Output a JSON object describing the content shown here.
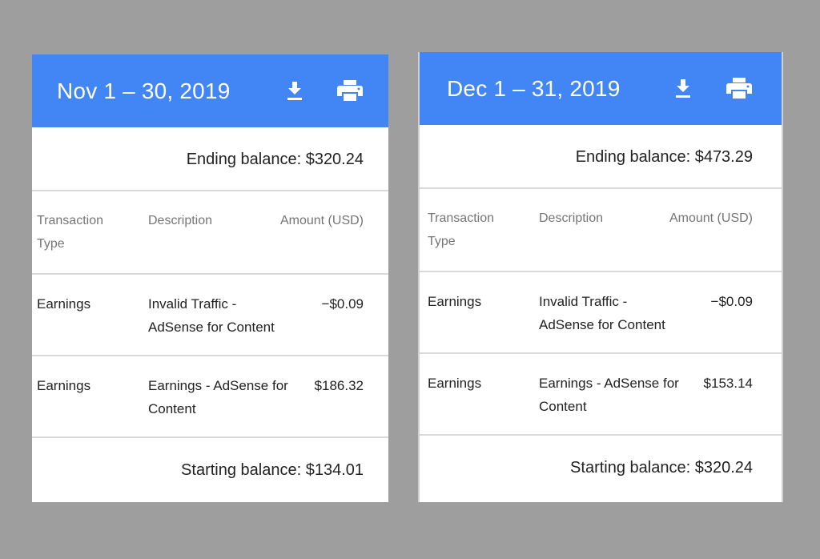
{
  "colors": {
    "header_bg": "#4285f4",
    "page_bg": "#9e9e9e",
    "card_bg": "#ffffff",
    "divider": "#d9d9d9"
  },
  "statements": [
    {
      "title": "Nov 1 – 30, 2019",
      "icons": {
        "download": "download-icon",
        "print": "print-icon"
      },
      "ending_balance": "Ending balance: $320.24",
      "columns": {
        "type": "Transaction Type",
        "description": "Description",
        "amount": "Amount (USD)"
      },
      "transactions": [
        {
          "type": "Earnings",
          "description": "Invalid Traffic - AdSense for Content",
          "amount": "−$0.09"
        },
        {
          "type": "Earnings",
          "description": "Earnings - AdSense for Content",
          "amount": "$186.32"
        }
      ],
      "starting_balance": "Starting balance: $134.01"
    },
    {
      "title": "Dec 1 – 31, 2019",
      "icons": {
        "download": "download-icon",
        "print": "print-icon"
      },
      "ending_balance": "Ending balance: $473.29",
      "columns": {
        "type": "Transaction Type",
        "description": "Description",
        "amount": "Amount (USD)"
      },
      "transactions": [
        {
          "type": "Earnings",
          "description": "Invalid Traffic - AdSense for Content",
          "amount": "−$0.09"
        },
        {
          "type": "Earnings",
          "description": "Earnings - AdSense for Content",
          "amount": "$153.14"
        }
      ],
      "starting_balance": "Starting balance: $320.24"
    }
  ]
}
